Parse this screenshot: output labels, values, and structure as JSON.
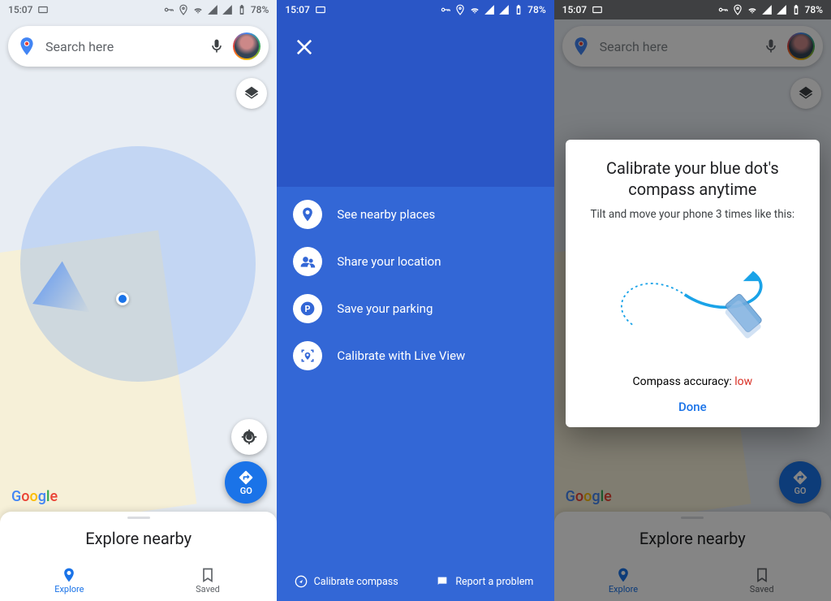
{
  "status": {
    "time": "15:07",
    "battery": "78%"
  },
  "search": {
    "placeholder": "Search here"
  },
  "go": {
    "label": "GO"
  },
  "sheet": {
    "title": "Explore nearby"
  },
  "nav": {
    "explore": "Explore",
    "saved": "Saved"
  },
  "watermark": {
    "g": "G",
    "o1": "o",
    "o2": "o",
    "g2": "g",
    "l": "l",
    "e": "e"
  },
  "menu": {
    "items": [
      {
        "label": "See nearby places"
      },
      {
        "label": "Share your location"
      },
      {
        "label": "Save your parking"
      },
      {
        "label": "Calibrate with Live View"
      }
    ],
    "footer": {
      "calibrate": "Calibrate compass",
      "report": "Report a problem"
    }
  },
  "dialog": {
    "title_l1": "Calibrate your blue dot's",
    "title_l2": "compass anytime",
    "subtitle": "Tilt and move your phone 3 times like this:",
    "accuracy_label": "Compass accuracy: ",
    "accuracy_value": "low",
    "done": "Done"
  }
}
